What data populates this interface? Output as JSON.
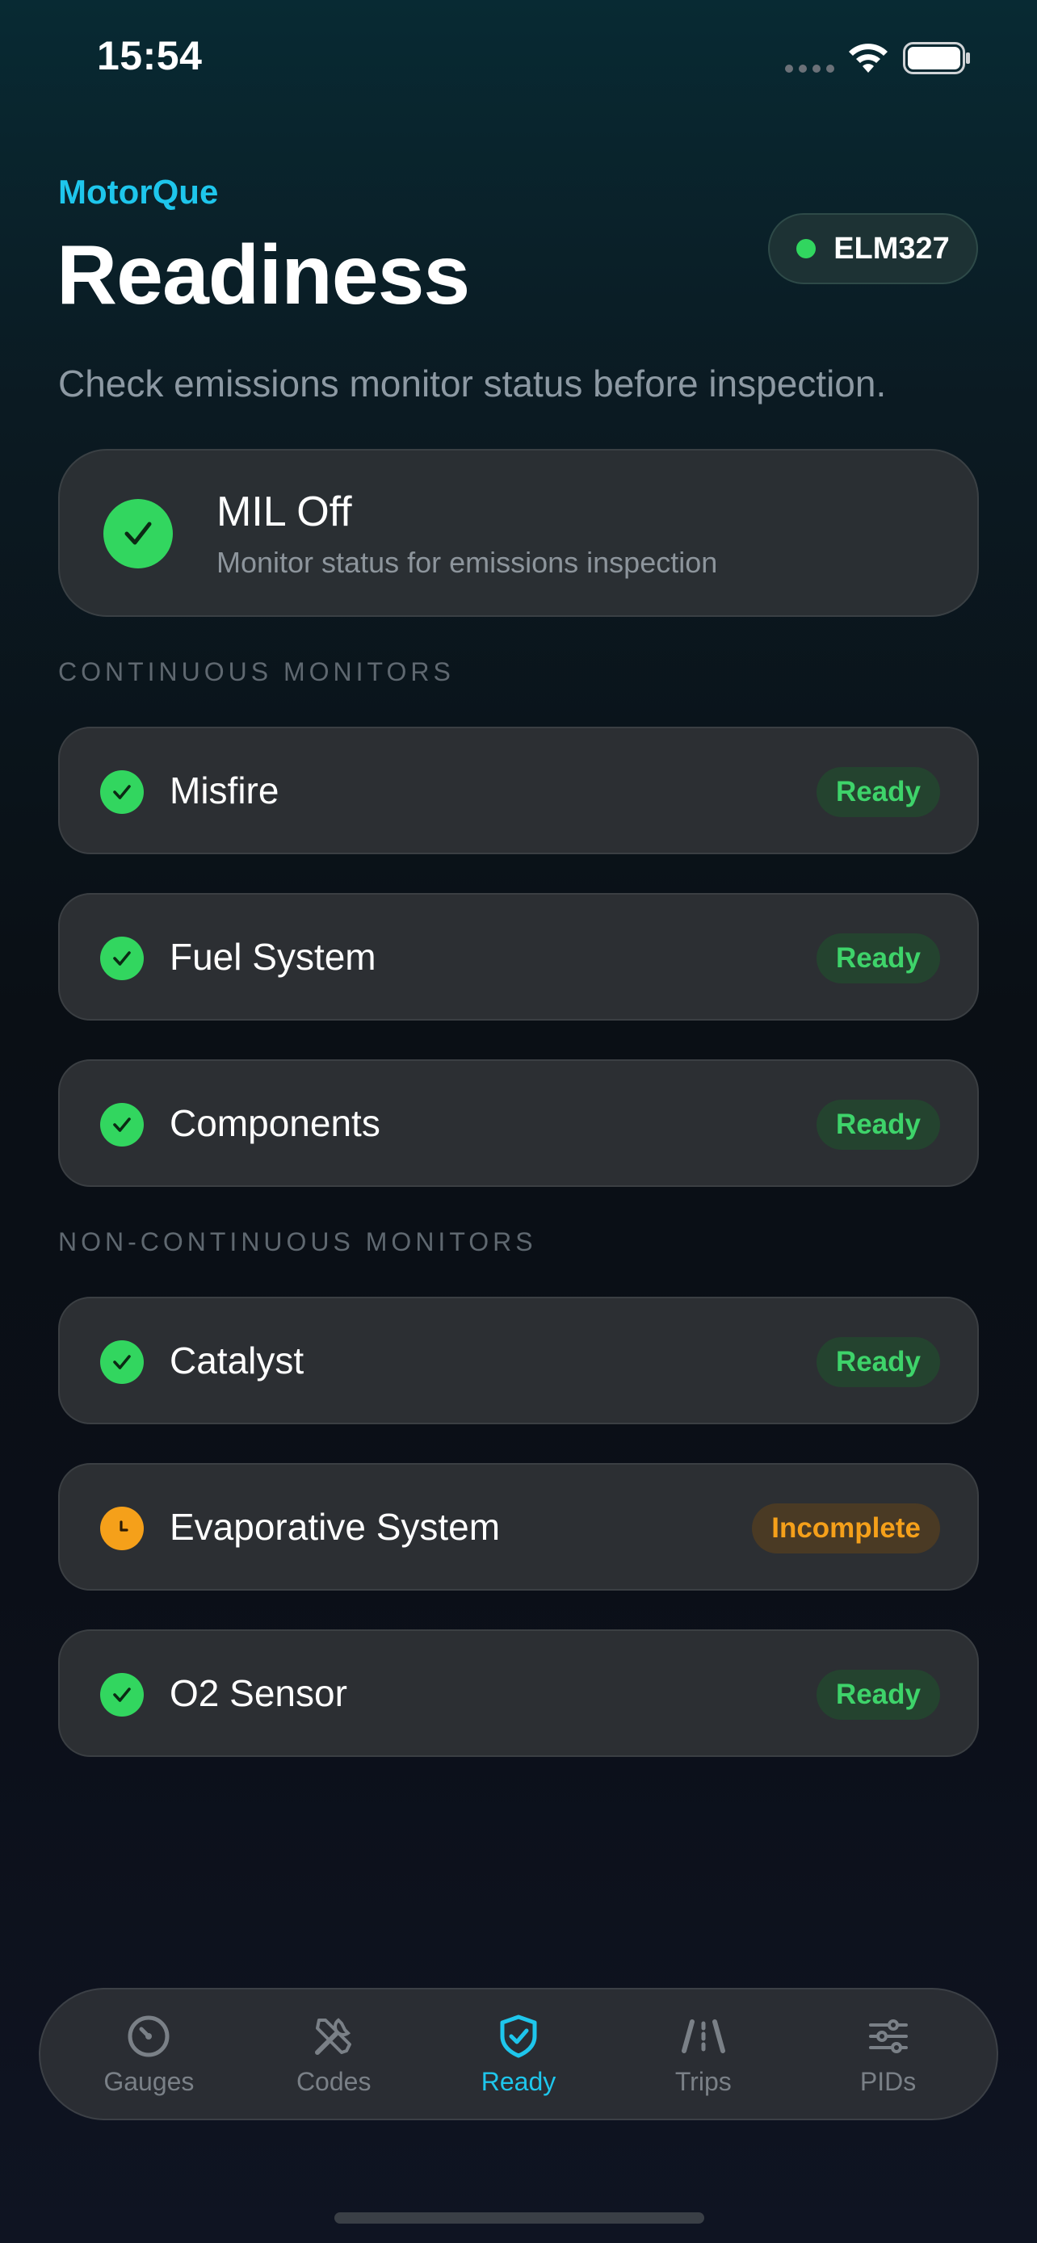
{
  "status_bar": {
    "time": "15:54"
  },
  "header": {
    "brand": "MotorQue",
    "title": "Readiness",
    "connection_label": "ELM327",
    "subtitle": "Check emissions monitor status before inspection."
  },
  "mil": {
    "title": "MIL Off",
    "subtitle": "Monitor status for emissions inspection",
    "status_icon": "check-icon"
  },
  "sections": {
    "continuous": {
      "label": "CONTINUOUS MONITORS",
      "items": [
        {
          "name": "Misfire",
          "status": "Ready"
        },
        {
          "name": "Fuel System",
          "status": "Ready"
        },
        {
          "name": "Components",
          "status": "Ready"
        }
      ]
    },
    "non_continuous": {
      "label": "NON-CONTINUOUS MONITORS",
      "items": [
        {
          "name": "Catalyst",
          "status": "Ready"
        },
        {
          "name": "Evaporative System",
          "status": "Incomplete"
        },
        {
          "name": "O2 Sensor",
          "status": "Ready"
        }
      ]
    }
  },
  "tabbar": {
    "tabs": [
      {
        "label": "Gauges",
        "icon": "gauge-icon"
      },
      {
        "label": "Codes",
        "icon": "tools-icon"
      },
      {
        "label": "Ready",
        "icon": "shield-check-icon",
        "active": true
      },
      {
        "label": "Trips",
        "icon": "road-icon"
      },
      {
        "label": "PIDs",
        "icon": "sliders-icon"
      }
    ]
  },
  "colors": {
    "accent": "#1ec6ec",
    "ready": "#32d65f",
    "incomplete": "#f5a01a",
    "card": "#2c2f33"
  }
}
